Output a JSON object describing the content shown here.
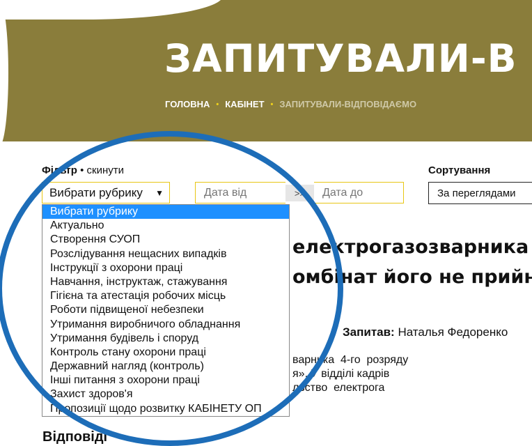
{
  "header": {
    "title": "ЗАПИТУВАЛИ-В",
    "breadcrumb": {
      "home": "ГОЛОВНА",
      "cabinet": "КАБІНЕТ",
      "current": "ЗАПИТУВАЛИ-ВІДПОВІДАЄМО",
      "separator": "•"
    },
    "banner_color": "#8a7d3b"
  },
  "filter": {
    "label": "Фільтр",
    "reset_separator": " • ",
    "reset_label": "скинути",
    "rubric_value": "Вибрати рубрику",
    "rubric_caret": "▼",
    "date_from_placeholder": "Дата від",
    "date_arrow": ">>",
    "date_to_placeholder": "Дата до",
    "rubric_options": [
      "Вибрати рубрику",
      "Актуально",
      "Створення СУОП",
      "Розслідування нещасних випадків",
      "Інструкції з охорони праці",
      "Навчання, інструктаж, стажування",
      "Гігієна та атестація робочих місць",
      "Роботи підвищеної небезпеки",
      "Утримання виробничого обладнання",
      "Утримання будівель і споруд",
      "Контроль стану охорони праці",
      "Державний нагляд (контроль)",
      "Інші питання з охорони праці",
      "Захист здоров'я",
      "Пропозиції щодо розвитку КАБІНЕТУ ОП"
    ],
    "selected_color": "#1e90ff"
  },
  "sort": {
    "label": "Сортування",
    "value": "За переглядами"
  },
  "article": {
    "title_line1": "електрогазозварника",
    "title_line2": "омбінат його не прийн",
    "asked_label": "Запитав:",
    "asked_name": " Наталья Федоренко",
    "body": "варника  4-го  розряду\nя». У відділі кадрів\nльство  електрога"
  },
  "answers": {
    "label": "Відповіді"
  },
  "accent": {
    "field_border": "#e8c614",
    "circle": "#1d6db8"
  }
}
